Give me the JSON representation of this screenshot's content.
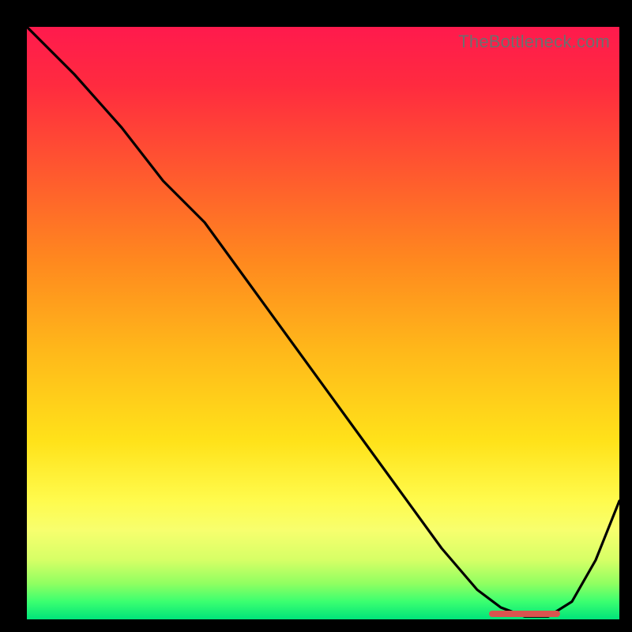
{
  "watermark": "TheBottleneck.com",
  "chart_data": {
    "type": "line",
    "title": "",
    "xlabel": "",
    "ylabel": "",
    "xlim": [
      0,
      100
    ],
    "ylim": [
      0,
      100
    ],
    "grid": false,
    "series": [
      {
        "name": "curve",
        "x": [
          0,
          8,
          16,
          23,
          30,
          38,
          46,
          54,
          62,
          70,
          76,
          80,
          84,
          88,
          92,
          96,
          100
        ],
        "y": [
          100,
          92,
          83,
          74,
          67,
          56,
          45,
          34,
          23,
          12,
          5,
          2,
          0.5,
          0.5,
          3,
          10,
          20
        ]
      }
    ],
    "optimal_band": {
      "x_start": 78,
      "x_end": 90,
      "y": 1.0
    },
    "colors": {
      "gradient_top": "#ff1a4d",
      "gradient_mid": "#ffe21a",
      "gradient_bottom": "#00e47a",
      "curve": "#000000",
      "marker": "#d9544f",
      "background": "#000000"
    }
  }
}
